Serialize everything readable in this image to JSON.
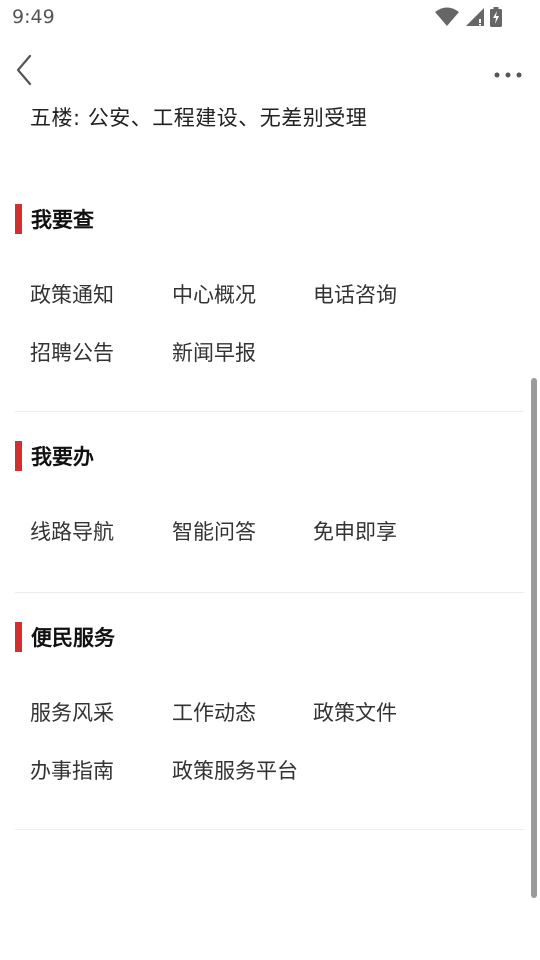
{
  "status": {
    "time": "9:49",
    "icons": [
      "wifi-icon",
      "cell-signal-icon",
      "battery-charging-icon"
    ]
  },
  "app_bar": {
    "back_icon": "chevron-left-icon",
    "more_icon": "more-horizontal-icon"
  },
  "floor_text": "五楼: 公安、工程建设、无差别受理",
  "colors": {
    "accent": "#d32f2f",
    "divider": "#ececec",
    "text": "#333333"
  },
  "sections": [
    {
      "title": "我要查",
      "items": [
        "政策通知",
        "中心概况",
        "电话咨询",
        "招聘公告",
        "新闻早报"
      ]
    },
    {
      "title": "我要办",
      "items": [
        "线路导航",
        "智能问答",
        "免申即享"
      ]
    },
    {
      "title": "便民服务",
      "items": [
        "服务风采",
        "工作动态",
        "政策文件",
        "办事指南",
        "政策服务平台"
      ]
    }
  ]
}
